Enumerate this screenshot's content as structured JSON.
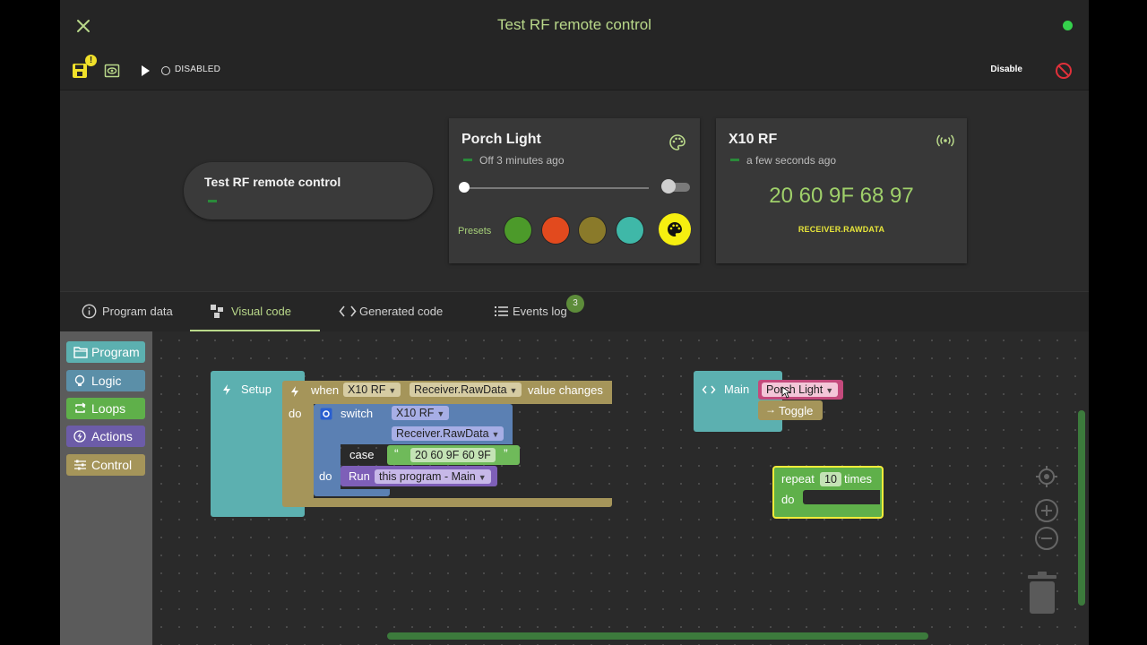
{
  "header": {
    "title": "Test RF remote control",
    "status_color": "#35d14c"
  },
  "toolbar": {
    "warning_badge": "!",
    "status_label": "DISABLED",
    "disable_label": "Disable"
  },
  "dashboard": {
    "program_pill": {
      "title": "Test RF remote control"
    },
    "porch_light": {
      "title": "Porch Light",
      "subtitle": "Off 3 minutes ago",
      "brightness": 0,
      "switch_on": false,
      "presets_label": "Presets",
      "presets": [
        "#4c9a2a",
        "#e24a1e",
        "#8a7a2a",
        "#3fb8a8"
      ],
      "preset_button_color": "#f6ef10"
    },
    "x10_rf": {
      "title": "X10 RF",
      "subtitle": "a few seconds ago",
      "value": "20 60 9F 68 97",
      "key": "RECEIVER.RAWDATA"
    }
  },
  "tabs": [
    {
      "label": "Program data",
      "icon": "info-icon"
    },
    {
      "label": "Visual code",
      "icon": "blocks-icon",
      "active": true
    },
    {
      "label": "Generated code",
      "icon": "code-icon"
    },
    {
      "label": "Events log",
      "icon": "list-icon",
      "badge": "3"
    }
  ],
  "toolbox": [
    {
      "label": "Program",
      "color": "#5cb0b0",
      "icon": "folder-icon"
    },
    {
      "label": "Logic",
      "color": "#5b8fa8",
      "icon": "bulb-icon"
    },
    {
      "label": "Loops",
      "color": "#5fb04a",
      "icon": "loop-icon"
    },
    {
      "label": "Actions",
      "color": "#6c5ca8",
      "icon": "bolt-icon"
    },
    {
      "label": "Control",
      "color": "#a5955a",
      "icon": "sliders-icon"
    }
  ],
  "blocks": {
    "setup": {
      "label": "Setup",
      "when": "when",
      "device": "X10 RF",
      "property": "Receiver.RawData",
      "changes": "value changes",
      "do": "do",
      "switch": "switch",
      "switch_device": "X10 RF",
      "switch_property": "Receiver.RawData",
      "case": "case",
      "case_value": "20 60 9F 60 9F",
      "case_do": "do",
      "run": "Run",
      "run_target": "this program - Main"
    },
    "main": {
      "label": "Main",
      "device": "Porch Light",
      "action": "Toggle"
    },
    "repeat": {
      "label": "repeat",
      "count": "10",
      "times": "times",
      "do": "do"
    }
  }
}
